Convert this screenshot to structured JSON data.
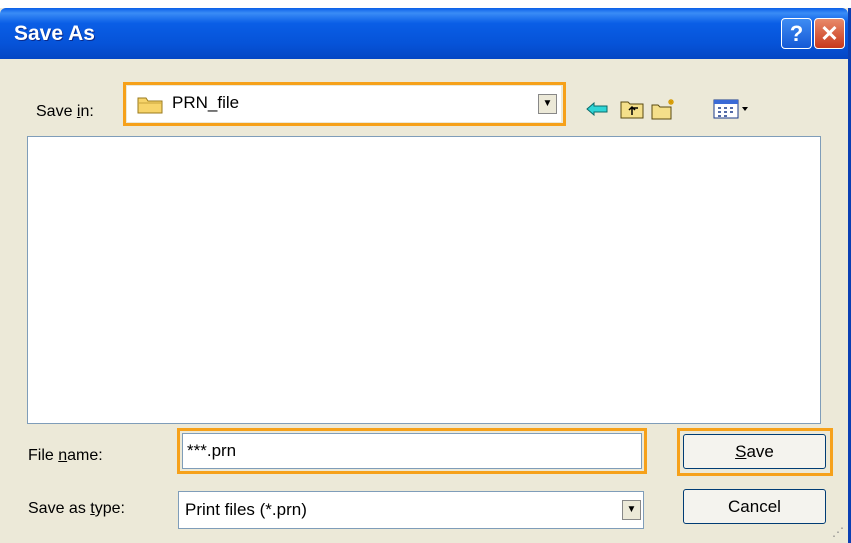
{
  "dialog": {
    "title": "Save As",
    "help_glyph": "?",
    "close_glyph": "✕"
  },
  "save_in": {
    "label_pre": "Save ",
    "label_key": "i",
    "label_post": "n:",
    "folder": "PRN_file"
  },
  "toolbar": {
    "icons": [
      "back-arrow-icon",
      "up-folder-icon",
      "new-folder-icon",
      "views-menu-icon"
    ]
  },
  "file_list": {
    "items": []
  },
  "file_name": {
    "label_pre": "File ",
    "label_key": "n",
    "label_post": "ame:",
    "value": "***.prn"
  },
  "save_type": {
    "label_pre": "Save as ",
    "label_key": "t",
    "label_post": "ype:",
    "value": "Print files (*.prn)"
  },
  "buttons": {
    "save_key": "S",
    "save_rest": "ave",
    "cancel": "Cancel"
  },
  "colors": {
    "title_bar": "#0653d8",
    "highlight": "#f6a11a",
    "dialog_bg": "#ece9d8"
  }
}
